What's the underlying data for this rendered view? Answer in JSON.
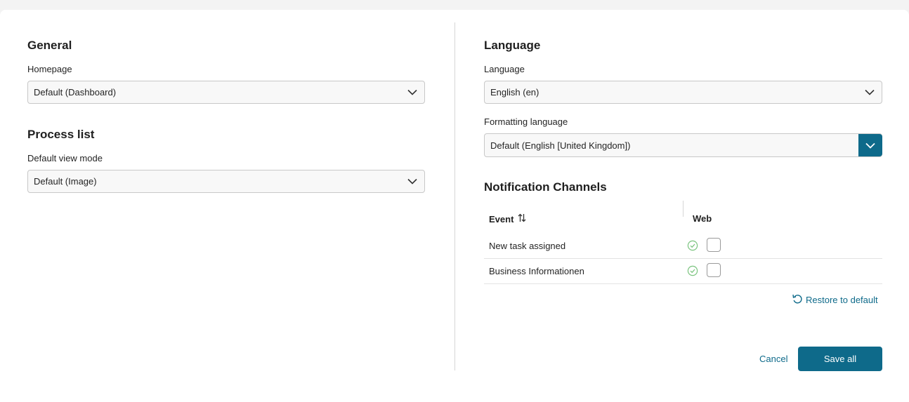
{
  "general": {
    "title": "General",
    "homepage_label": "Homepage",
    "homepage_value": "Default (Dashboard)"
  },
  "process_list": {
    "title": "Process list",
    "view_mode_label": "Default view mode",
    "view_mode_value": "Default (Image)"
  },
  "language": {
    "title": "Language",
    "language_label": "Language",
    "language_value": "English (en)",
    "formatting_label": "Formatting language",
    "formatting_value": "Default (English [United Kingdom])"
  },
  "notifications": {
    "title": "Notification Channels",
    "columns": {
      "event": "Event",
      "web": "Web"
    },
    "rows": [
      {
        "event": "New task assigned",
        "web_default": true,
        "web_checked": false
      },
      {
        "event": "Business Informationen",
        "web_default": true,
        "web_checked": false
      }
    ],
    "restore_label": "Restore to default"
  },
  "actions": {
    "cancel_label": "Cancel",
    "save_label": "Save all"
  },
  "icons": {
    "chevron": "chevron-down-icon",
    "sort": "sort-icon",
    "default_check": "check-circle-icon",
    "restore": "undo-icon"
  },
  "colors": {
    "accent": "#0e6a8a",
    "check_green": "#7bc47f",
    "divider": "#d6d6d6"
  }
}
